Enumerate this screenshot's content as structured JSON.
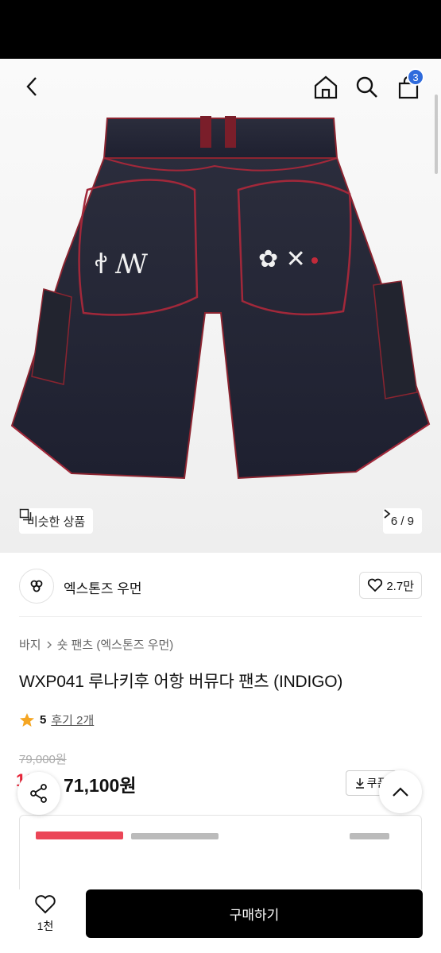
{
  "header": {
    "back_icon": "chevron-left-icon",
    "home_icon": "home-icon",
    "search_icon": "search-icon",
    "cart_icon": "shopping-bag-icon",
    "cart_count": "3"
  },
  "gallery": {
    "similar_label": "비슷한 상품",
    "counter": "6 / 9"
  },
  "brand": {
    "name": "엑스톤즈 우먼",
    "likes": "2.7만"
  },
  "breadcrumb": {
    "category": "바지",
    "subcategory": "숏 팬츠 (엑스톤즈 우먼)"
  },
  "product": {
    "title": "WXP041 루나키후 어항 버뮤다 팬츠 (INDIGO)",
    "rating": "5",
    "reviews": "후기 2개",
    "original_price": "79,000원",
    "discount": "10%",
    "price": "71,100원",
    "coupon_label": "쿠폰"
  },
  "bottom": {
    "wish_count": "1천",
    "buy_label": "구매하기"
  },
  "colors": {
    "accent_blue": "#2f6bdc",
    "discount_red": "#e8263a",
    "buy_button": "#000000"
  }
}
